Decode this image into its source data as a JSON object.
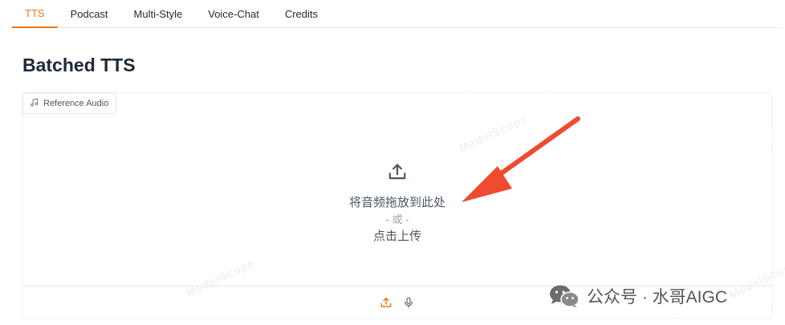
{
  "tabs": [
    {
      "label": "TTS",
      "active": true
    },
    {
      "label": "Podcast",
      "active": false
    },
    {
      "label": "Multi-Style",
      "active": false
    },
    {
      "label": "Voice-Chat",
      "active": false
    },
    {
      "label": "Credits",
      "active": false
    }
  ],
  "page": {
    "title": "Batched TTS"
  },
  "audio": {
    "label": "Reference Audio",
    "drop_text": "将音频拖放到此处",
    "or_text": "- 或 -",
    "click_text": "点击上传"
  },
  "watermarks": [
    "ModelScope",
    "ModelScope",
    "ModelScope"
  ],
  "overlay": {
    "wechat_text": "公众号 · 水哥AIGC"
  },
  "colors": {
    "accent": "#ea7a1b",
    "arrow": "#ef4b2f"
  }
}
